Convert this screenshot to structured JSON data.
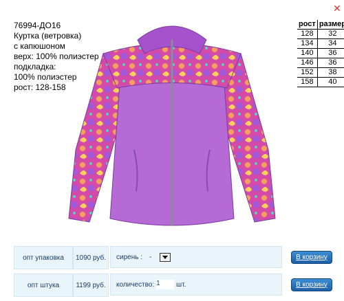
{
  "product": {
    "code": "76994-ДО16",
    "name": "Куртка (ветровка)",
    "name2": "с капюшоном",
    "outer": "верх: 100% полиэстер",
    "lining_label": "подкладка:",
    "lining": "100% полиэстер",
    "height": "рост: 128-158"
  },
  "size_table": {
    "headers": [
      "рост",
      "размер"
    ],
    "rows": [
      [
        "128",
        "32"
      ],
      [
        "134",
        "34"
      ],
      [
        "140",
        "36"
      ],
      [
        "146",
        "36"
      ],
      [
        "152",
        "38"
      ],
      [
        "158",
        "40"
      ]
    ]
  },
  "close_icon": "close-icon",
  "offers": [
    {
      "label": "опт упаковка",
      "price": "1090 руб.",
      "option_label": "сирень :",
      "option_value": "-",
      "button": "В корзину"
    },
    {
      "label": "опт штука",
      "price": "1199 руб.",
      "option_label": "количество:",
      "option_value": "1",
      "unit": "шт.",
      "button": "В корзину"
    }
  ],
  "colors": {
    "accent": "#1d5fa8",
    "row_bg": "#eaf4fb",
    "jacket": "#b56ad6"
  }
}
